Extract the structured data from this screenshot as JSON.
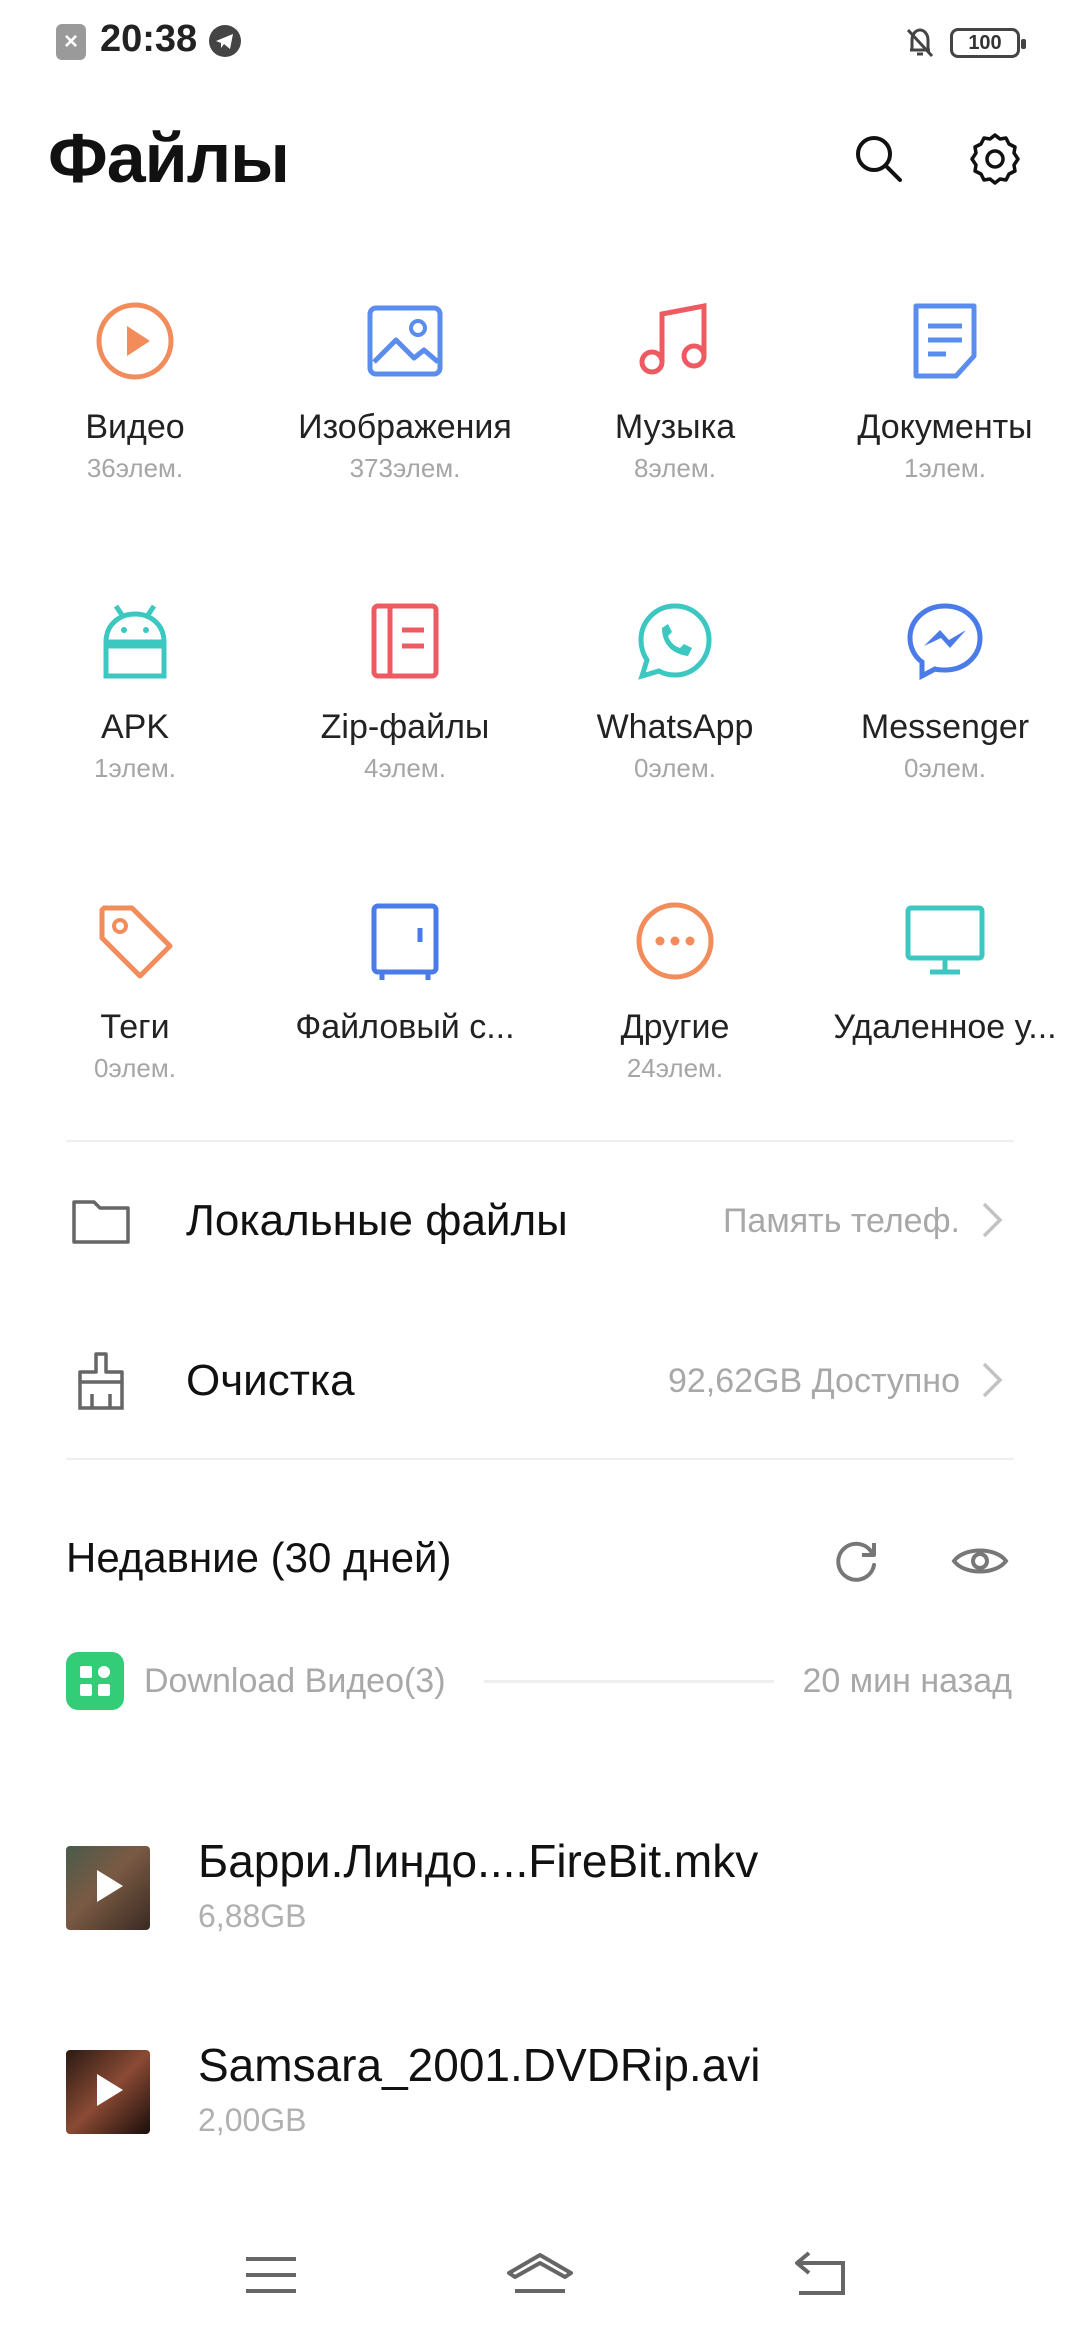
{
  "status_bar": {
    "time": "20:38",
    "battery": "100",
    "icons": [
      "notification-x-icon",
      "telegram-icon",
      "bell-off-icon",
      "battery-icon"
    ]
  },
  "header": {
    "title": "Файлы",
    "icons": [
      "search-icon",
      "gear-icon"
    ]
  },
  "categories": [
    {
      "label": "Видео",
      "count": "36элем.",
      "icon": "video-icon",
      "color": "#f28c5a"
    },
    {
      "label": "Изображения",
      "count": "373элем.",
      "icon": "image-icon",
      "color": "#5b8def"
    },
    {
      "label": "Музыка",
      "count": "8элем.",
      "icon": "music-icon",
      "color": "#ef5a62"
    },
    {
      "label": "Документы",
      "count": "1элем.",
      "icon": "document-icon",
      "color": "#5b8def"
    },
    {
      "label": "APK",
      "count": "1элем.",
      "icon": "android-icon",
      "color": "#3cc7c0"
    },
    {
      "label": "Zip-файлы",
      "count": "4элем.",
      "icon": "zip-icon",
      "color": "#ef5a62"
    },
    {
      "label": "WhatsApp",
      "count": "0элем.",
      "icon": "whatsapp-icon",
      "color": "#3cc7c0"
    },
    {
      "label": "Messenger",
      "count": "0элем.",
      "icon": "messenger-icon",
      "color": "#4a7be8"
    },
    {
      "label": "Теги",
      "count": "0элем.",
      "icon": "tag-icon",
      "color": "#f28c5a"
    },
    {
      "label": "Файловый с...",
      "count": "",
      "icon": "safe-icon",
      "color": "#4a7be8"
    },
    {
      "label": "Другие",
      "count": "24элем.",
      "icon": "more-icon",
      "color": "#f28c5a"
    },
    {
      "label": "Удаленное у...",
      "count": "",
      "icon": "monitor-icon",
      "color": "#3cc7c0"
    }
  ],
  "locations": [
    {
      "title": "Локальные файлы",
      "subtitle": "Память телеф.",
      "icon": "folder-icon"
    },
    {
      "title": "Очистка",
      "subtitle": "92,62GB Доступно",
      "icon": "broom-icon"
    }
  ],
  "recent": {
    "title": "Недавние (30 дней)",
    "group_label": "Download Видео(3)",
    "group_time": "20 мин назад",
    "files": [
      {
        "name": "Барри.Линдо....FireBit.mkv",
        "size": "6,88GB"
      },
      {
        "name": "Samsara_2001.DVDRip.avi",
        "size": "2,00GB"
      }
    ]
  },
  "nav": {
    "icons": [
      "menu-icon",
      "home-icon",
      "back-icon"
    ]
  }
}
